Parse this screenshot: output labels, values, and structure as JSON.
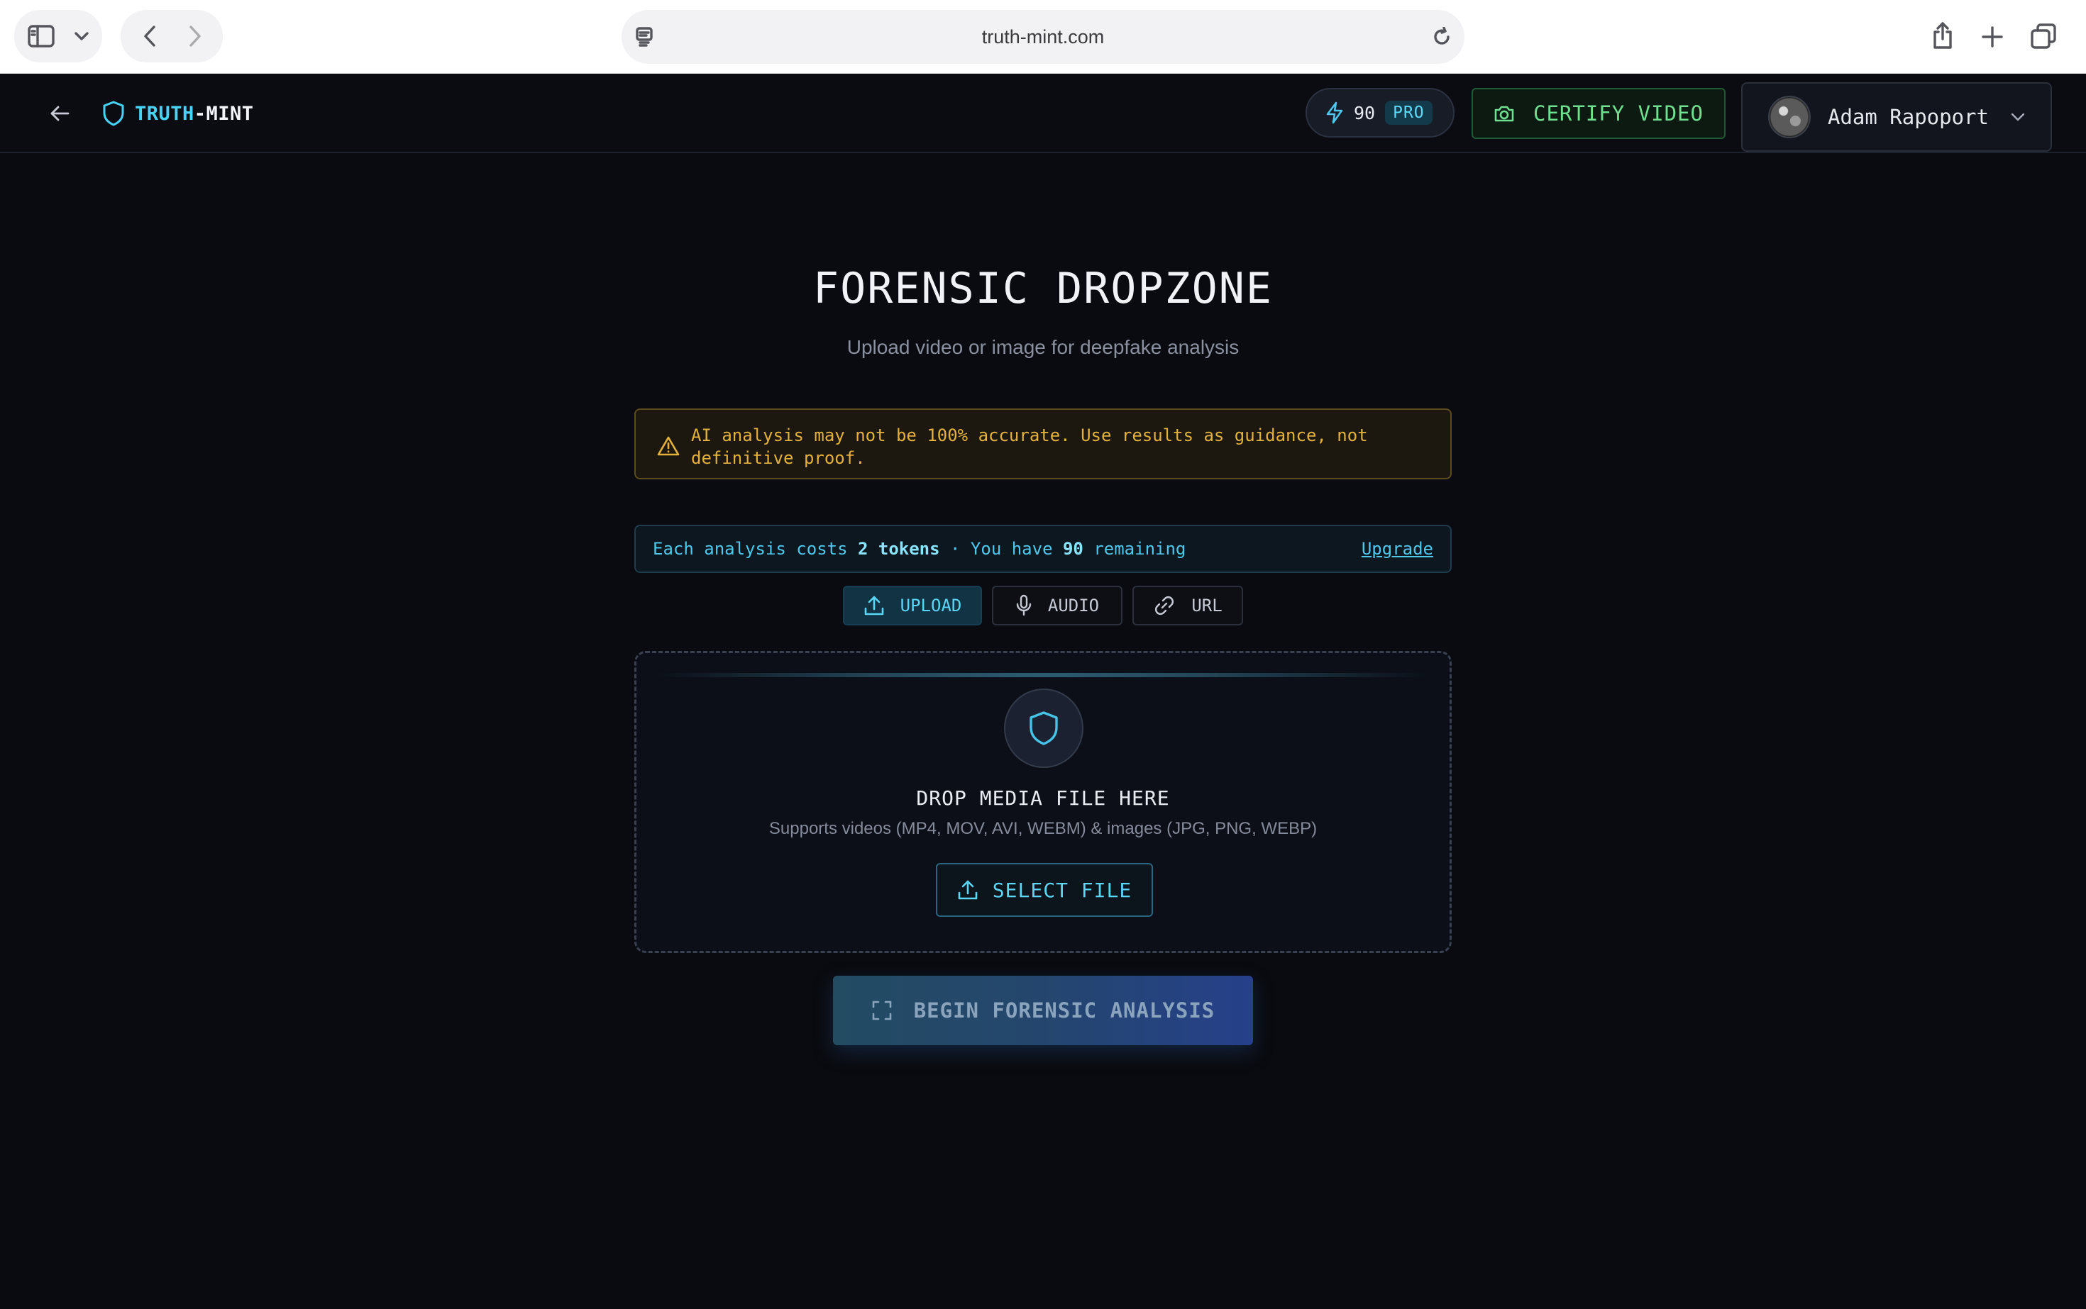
{
  "browser": {
    "url": "truth-mint.com"
  },
  "header": {
    "brand_part1": "TRUTH",
    "brand_part2": "-MINT",
    "token_count": "90",
    "plan_badge": "PRO",
    "certify_label": "CERTIFY VIDEO",
    "user_name": "Adam Rapoport"
  },
  "main": {
    "title": "FORENSIC DROPZONE",
    "subtitle": "Upload video or image for deepfake analysis",
    "warning": "AI analysis may not be 100% accurate. Use results as guidance, not definitive proof.",
    "cost": {
      "prefix": "Each analysis costs ",
      "cost_value": "2 tokens",
      "middle": " · You have ",
      "remaining_value": "90",
      "suffix": " remaining",
      "upgrade_label": "Upgrade"
    },
    "tabs": [
      {
        "label": "UPLOAD",
        "active": true
      },
      {
        "label": "AUDIO",
        "active": false
      },
      {
        "label": "URL",
        "active": false
      }
    ],
    "dropzone": {
      "title": "DROP MEDIA FILE HERE",
      "subtitle": "Supports videos (MP4, MOV, AVI, WEBM) & images (JPG, PNG, WEBP)",
      "select_label": "SELECT FILE"
    },
    "begin_label": "BEGIN FORENSIC ANALYSIS"
  },
  "colors": {
    "background": "#0a0b10",
    "accent_cyan": "#46d3f5",
    "accent_green": "#6ee08f",
    "warning_amber": "#e4b23c"
  },
  "icons": [
    "sidebar-icon",
    "chevron-down-icon",
    "back-icon",
    "forward-icon",
    "reader-icon",
    "reload-icon",
    "share-icon",
    "plus-icon",
    "tabs-icon",
    "arrow-left-icon",
    "shield-icon",
    "lightning-icon",
    "camera-icon",
    "warning-icon",
    "upload-icon",
    "microphone-icon",
    "link-icon",
    "scan-icon"
  ]
}
